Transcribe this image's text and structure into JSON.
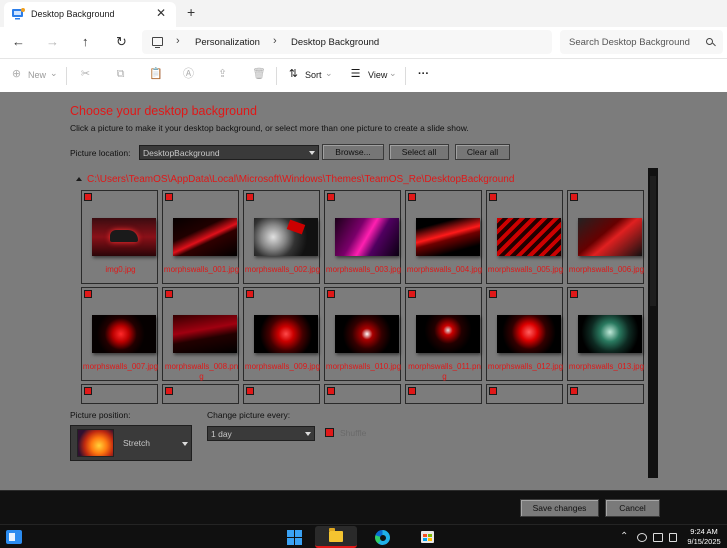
{
  "window": {
    "tab_title": "Desktop Background",
    "tab_close": "✕",
    "new_tab": "+"
  },
  "nav": {
    "back": "←",
    "forward": "→",
    "up": "↑",
    "refresh": "↻"
  },
  "address": {
    "sep": "›",
    "crumbs": [
      "Personalization",
      "Desktop Background"
    ],
    "search_placeholder": "Search Desktop Background"
  },
  "commands": {
    "new_label": "New",
    "sort_label": "Sort",
    "view_label": "View",
    "more_label": "···",
    "chevron": "⌄",
    "icons": {
      "new": "⊕",
      "cut": "✂",
      "copy": "⧉",
      "paste": "📋",
      "rename": "Ⓐ",
      "share": "⇪",
      "delete": "🗑",
      "sort": "⇅",
      "view": "☰"
    }
  },
  "dialog": {
    "heading": "Choose your desktop background",
    "subheading": "Click a picture to make it your desktop background, or select more than one picture to create a slide show.",
    "location_label": "Picture location:",
    "location_value": "DesktopBackground",
    "browse_label": "Browse...",
    "select_all_label": "Select all",
    "clear_all_label": "Clear all",
    "folder_path": "C:\\Users\\TeamOS\\AppData\\Local\\Microsoft\\Windows\\Themes\\TeamOS_Re\\DesktopBackground",
    "pictures": [
      "img0.jpg",
      "morphswalls_001.jpg",
      "morphswalls_002.jpg",
      "morphswalls_003.jpg",
      "morphswalls_004.jpg",
      "morphswalls_005.jpg",
      "morphswalls_006.jpg",
      "morphswalls_007.jpg",
      "morphswalls_008.png",
      "morphswalls_009.jpg",
      "morphswalls_010.jpg",
      "morphswalls_011.png",
      "morphswalls_012.jpg",
      "morphswalls_013.jpg"
    ],
    "position_label": "Picture position:",
    "position_value": "Stretch",
    "change_label": "Change picture every:",
    "change_value": "1 day",
    "shuffle_label": "Shuffle",
    "save_label": "Save changes",
    "cancel_label": "Cancel"
  },
  "colors": {
    "accent_red": "#e01818",
    "dim_gray": "#7c7c7c"
  },
  "taskbar": {
    "tray_chevron": "⌃",
    "time": "9:24 AM",
    "date": "9/15/2025"
  }
}
